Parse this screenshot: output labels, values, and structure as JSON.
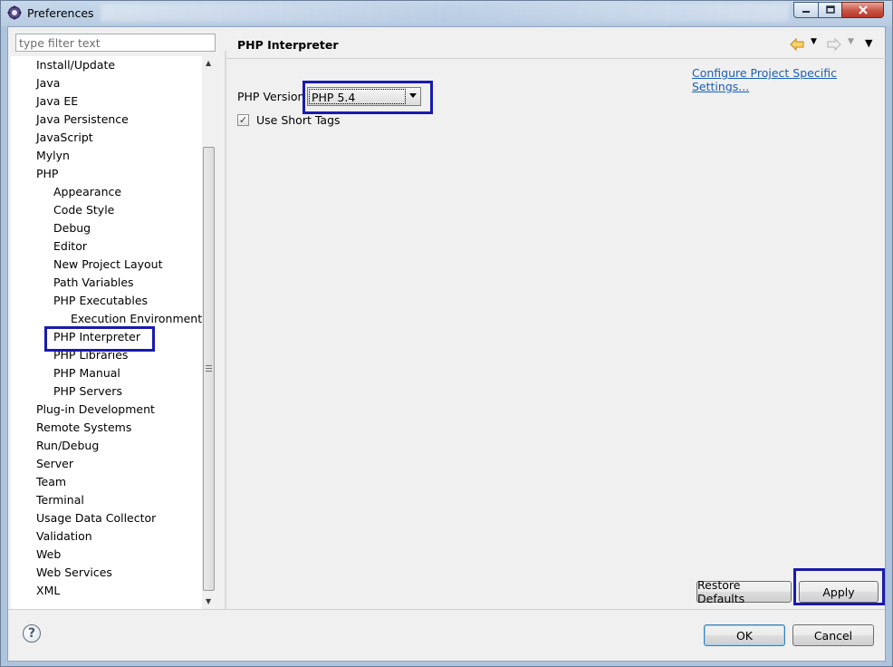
{
  "window": {
    "title": "Preferences",
    "icon": "eclipse-gear-icon",
    "close_color": "#c85443"
  },
  "filter": {
    "placeholder": "type filter text",
    "value": ""
  },
  "tree": {
    "selected": "PHP Interpreter",
    "items": [
      {
        "label": "Install/Update",
        "level": 0
      },
      {
        "label": "Java",
        "level": 0
      },
      {
        "label": "Java EE",
        "level": 0
      },
      {
        "label": "Java Persistence",
        "level": 0
      },
      {
        "label": "JavaScript",
        "level": 0
      },
      {
        "label": "Mylyn",
        "level": 0
      },
      {
        "label": "PHP",
        "level": 0
      },
      {
        "label": "Appearance",
        "level": 1
      },
      {
        "label": "Code Style",
        "level": 1
      },
      {
        "label": "Debug",
        "level": 1
      },
      {
        "label": "Editor",
        "level": 1
      },
      {
        "label": "New Project Layout",
        "level": 1
      },
      {
        "label": "Path Variables",
        "level": 1
      },
      {
        "label": "PHP Executables",
        "level": 1
      },
      {
        "label": "Execution Environments",
        "level": 2
      },
      {
        "label": "PHP Interpreter",
        "level": 1
      },
      {
        "label": "PHP Libraries",
        "level": 1
      },
      {
        "label": "PHP Manual",
        "level": 1
      },
      {
        "label": "PHP Servers",
        "level": 1
      },
      {
        "label": "Plug-in Development",
        "level": 0
      },
      {
        "label": "Remote Systems",
        "level": 0
      },
      {
        "label": "Run/Debug",
        "level": 0
      },
      {
        "label": "Server",
        "level": 0
      },
      {
        "label": "Team",
        "level": 0
      },
      {
        "label": "Terminal",
        "level": 0
      },
      {
        "label": "Usage Data Collector",
        "level": 0
      },
      {
        "label": "Validation",
        "level": 0
      },
      {
        "label": "Web",
        "level": 0
      },
      {
        "label": "Web Services",
        "level": 0
      },
      {
        "label": "XML",
        "level": 0
      }
    ]
  },
  "page": {
    "title": "PHP Interpreter",
    "config_link": "Configure Project Specific Settings...",
    "version_label": "PHP Version",
    "version_value": "PHP 5.4",
    "short_tags_label": "Use Short Tags",
    "short_tags_checked": true
  },
  "buttons": {
    "restore_defaults": "Restore Defaults",
    "apply": "Apply",
    "ok": "OK",
    "cancel": "Cancel"
  },
  "colors": {
    "highlight_box": "#1a1aae",
    "link": "#1a5fb4",
    "back_arrow": "#e3a21a"
  }
}
